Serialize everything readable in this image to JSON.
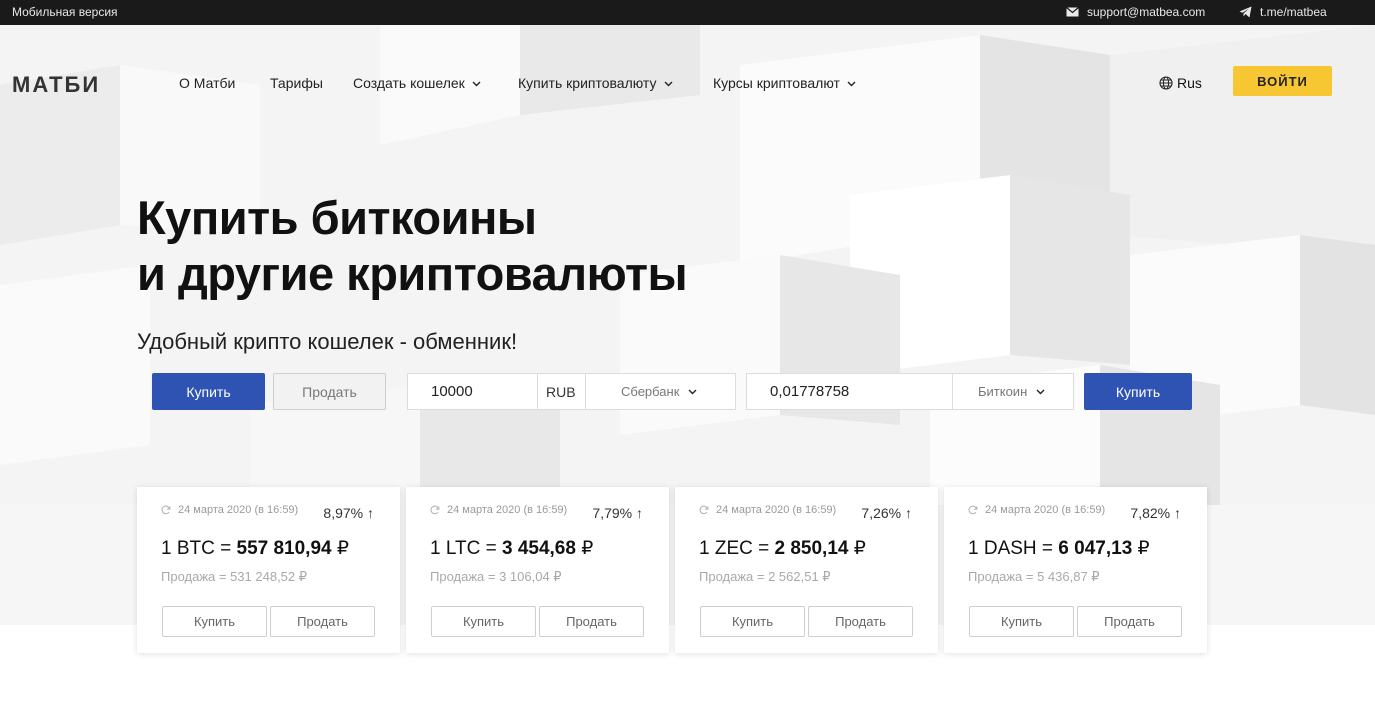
{
  "topbar": {
    "mobile_label": "Мобильная версия",
    "email": "support@matbea.com",
    "telegram": "t.me/matbea",
    "icons": [
      "mail-icon",
      "telegram-icon"
    ]
  },
  "header": {
    "logo": "МАТБИ",
    "nav": [
      {
        "label": "О Матби",
        "dropdown": false
      },
      {
        "label": "Тарифы",
        "dropdown": false
      },
      {
        "label": "Создать кошелек",
        "dropdown": true
      },
      {
        "label": "Купить криптовалюту",
        "dropdown": true
      },
      {
        "label": "Курсы криптовалют",
        "dropdown": true
      }
    ],
    "lang": "Rus",
    "login_label": "ВОЙТИ"
  },
  "hero": {
    "title_line1": "Купить биткоины",
    "title_line2": "и другие криптовалюты",
    "subtitle": "Удобный крипто кошелек - обменник!"
  },
  "exchange": {
    "buy_tab": "Купить",
    "sell_tab": "Продать",
    "amount_value": "10000",
    "currency": "RUB",
    "payment_method": "Сбербанк",
    "crypto_amount_value": "0,01778758",
    "crypto": "Биткоин",
    "submit_label": "Купить"
  },
  "cards": [
    {
      "timestamp": "24 марта 2020 (в 16:59)",
      "change": "8,97% ↑",
      "pair_prefix": "1 BTC = ",
      "price": "557 810,94",
      "currency_sign": "₽",
      "sell": "Продажа = 531 248,52 ₽",
      "buy_label": "Купить",
      "sell_label": "Продать"
    },
    {
      "timestamp": "24 марта 2020 (в 16:59)",
      "change": "7,79% ↑",
      "pair_prefix": "1 LTC = ",
      "price": "3 454,68",
      "currency_sign": "₽",
      "sell": "Продажа = 3 106,04 ₽",
      "buy_label": "Купить",
      "sell_label": "Продать"
    },
    {
      "timestamp": "24 марта 2020 (в 16:59)",
      "change": "7,26% ↑",
      "pair_prefix": "1 ZEC = ",
      "price": "2 850,14",
      "currency_sign": "₽",
      "sell": "Продажа = 2 562,51 ₽",
      "buy_label": "Купить",
      "sell_label": "Продать"
    },
    {
      "timestamp": "24 марта 2020 (в 16:59)",
      "change": "7,82% ↑",
      "pair_prefix": "1 DASH = ",
      "price": "6 047,13",
      "currency_sign": "₽",
      "sell": "Продажа = 5 436,87 ₽",
      "buy_label": "Купить",
      "sell_label": "Продать"
    }
  ],
  "colors": {
    "accent_blue": "#2f53b3",
    "login_yellow": "#f7c633",
    "topbar_bg": "#1a1a1a"
  }
}
